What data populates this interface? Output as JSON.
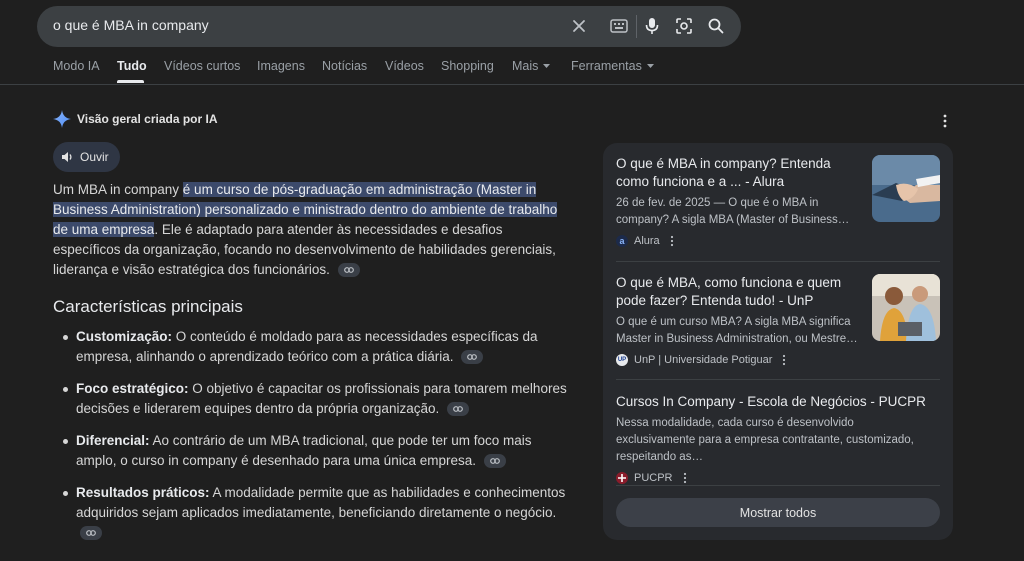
{
  "search": {
    "query": "o que é MBA in company"
  },
  "tabs": [
    {
      "label": "Modo IA"
    },
    {
      "label": "Tudo"
    },
    {
      "label": "Vídeos curtos"
    },
    {
      "label": "Imagens"
    },
    {
      "label": "Notícias"
    },
    {
      "label": "Vídeos"
    },
    {
      "label": "Shopping"
    },
    {
      "label": "Mais"
    },
    {
      "label": "Ferramentas"
    }
  ],
  "ai_overview": {
    "header": "Visão geral criada por IA",
    "listen_label": "Ouvir",
    "intro_pre": "Um MBA in company ",
    "intro_highlight": "é um curso de pós-graduação em administração (Master in Business Administration) personalizado e ministrado dentro do ambiente de trabalho de uma empresa",
    "intro_post": ". Ele é adaptado para atender às necessidades e desafios específicos da organização, focando no desenvolvimento de habilidades gerenciais, liderança e visão estratégica dos funcionários.",
    "section_title": "Características principais",
    "bullets": [
      {
        "term": "Customização:",
        "text": " O conteúdo é moldado para as necessidades específicas da empresa, alinhando o aprendizado teórico com a prática diária."
      },
      {
        "term": "Foco estratégico:",
        "text": " O objetivo é capacitar os profissionais para tomarem melhores decisões e liderarem equipes dentro da própria organização."
      },
      {
        "term": "Diferencial:",
        "text": " Ao contrário de um MBA tradicional, que pode ter um foco mais amplo, o curso in company é desenhado para uma única empresa."
      },
      {
        "term": "Resultados práticos:",
        "text": " A modalidade permite que as habilidades e conhecimentos adquiridos sejam aplicados imediatamente, beneficiando diretamente o negócio."
      }
    ]
  },
  "sources": [
    {
      "title": "O que é MBA in company? Entenda como funciona e a ... - Alura",
      "snippet": "26 de fev. de 2025 — O que é o MBA in company? A sigla MBA (Master of Business…",
      "source": "Alura",
      "favicon_letter": "a"
    },
    {
      "title": "O que é MBA, como funciona e quem pode fazer? Entenda tudo! - UnP",
      "snippet": "O que é um curso MBA? A sigla MBA significa Master in Business Administration, ou Mestre…",
      "source": "UnP | Universidade Potiguar",
      "favicon_letter": "UP"
    },
    {
      "title": "Cursos In Company - Escola de Negócios - PUCPR",
      "snippet": "Nessa modalidade, cada curso é desenvolvido exclusivamente para a empresa contratante, customizado, respeitando as…",
      "source": "PUCPR",
      "favicon_letter": ""
    }
  ],
  "show_all_label": "Mostrar todos",
  "colors": {
    "background": "#1f1f1f",
    "highlight": "#3c4a6b",
    "panel": "#282a2e",
    "accent_blue": "#8ab4f8"
  }
}
